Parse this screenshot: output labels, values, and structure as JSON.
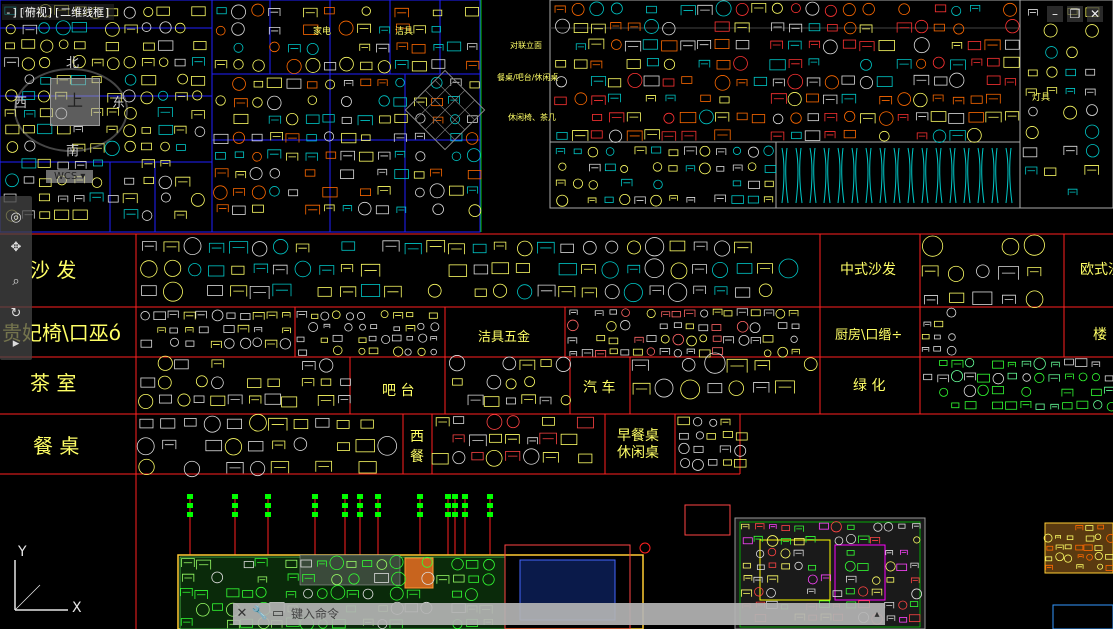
{
  "viewport_label": "-][俯视][二维线框]",
  "window_controls": {
    "minimize": "–",
    "restore": "❐",
    "close": "✕"
  },
  "viewcube": {
    "top": "上",
    "north": "北",
    "south": "南",
    "east": "东",
    "west": "西",
    "wcs": "WCS ▾"
  },
  "nav_tools": [
    "wheel-icon",
    "pan-icon",
    "zoom-icon",
    "orbit-icon",
    "showmotion-icon"
  ],
  "categories": [
    {
      "label": "沙 发"
    },
    {
      "label": "中式沙发"
    },
    {
      "label": "欧式沙"
    },
    {
      "label": "贵妃椅\\口巫ó"
    },
    {
      "label": "洁具五金"
    },
    {
      "label": "厨房\\口缗÷"
    },
    {
      "label": "楼"
    },
    {
      "label": "茶 室"
    },
    {
      "label": "吧 台"
    },
    {
      "label": "汽 车"
    },
    {
      "label": "绿 化"
    },
    {
      "label": "餐 桌"
    },
    {
      "label": "西\n餐"
    },
    {
      "label": "早餐桌\n休闲桌"
    }
  ],
  "small_labels": [
    "家电",
    "洁具",
    "对联立面",
    "餐桌/吧台/休闲桌",
    "休闲椅、茶几",
    "灯具"
  ],
  "command_line": {
    "placeholder": "键入命令",
    "close_icon": "close-icon",
    "customize_icon": "wrench-icon",
    "prompt_icon": "command-prompt-icon"
  },
  "ucs": {
    "x_label": "X",
    "y_label": "Y"
  },
  "colors": {
    "grid_red": "#ff2020",
    "blue_line": "#2020ff",
    "green_line": "#00c800",
    "cad_yellow": "#ffff66",
    "cad_cyan": "#00c8c8",
    "cad_orange": "#ff6a00"
  }
}
